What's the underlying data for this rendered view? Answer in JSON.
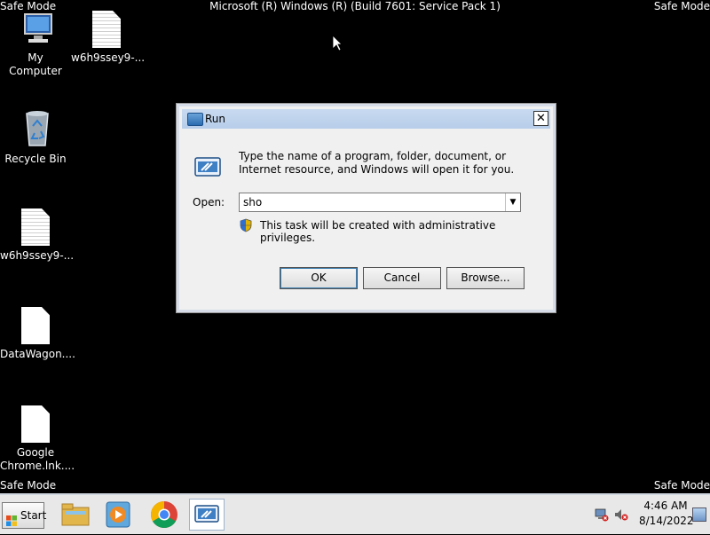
{
  "safe_mode_label": "Safe Mode",
  "top_title": "Microsoft (R) Windows (R) (Build 7601: Service Pack 1)",
  "desktop": {
    "icons": [
      {
        "label": "My Computer",
        "icon": "computer-icon"
      },
      {
        "label": "w6h9ssey9-...",
        "icon": "text-file-icon"
      },
      {
        "label": "Recycle Bin",
        "icon": "recycle-bin-icon"
      },
      {
        "label": "w6h9ssey9-...",
        "icon": "text-file-icon"
      },
      {
        "label": "DataWagon....",
        "icon": "blank-file-icon"
      },
      {
        "label": "Google Chrome.lnk....",
        "icon": "blank-file-icon"
      }
    ]
  },
  "run_dialog": {
    "title": "Run",
    "close_symbol": "✕",
    "description": "Type the name of a program, folder, document, or Internet resource, and Windows will open it for you.",
    "open_label": "Open:",
    "open_value": "sho",
    "admin_note": "This task will be created with administrative privileges.",
    "buttons": {
      "ok": "OK",
      "cancel": "Cancel",
      "browse": "Browse..."
    }
  },
  "taskbar": {
    "start_label": "Start",
    "pinned": [
      "windows-explorer-icon",
      "media-player-icon",
      "chrome-icon",
      "run-icon"
    ],
    "clock_time": "4:46 AM",
    "clock_date": "8/14/2022"
  },
  "colors": {
    "desktop_bg": "#000000",
    "titlebar": "#c8daf0",
    "dialog_bg": "#f0f0f0"
  }
}
